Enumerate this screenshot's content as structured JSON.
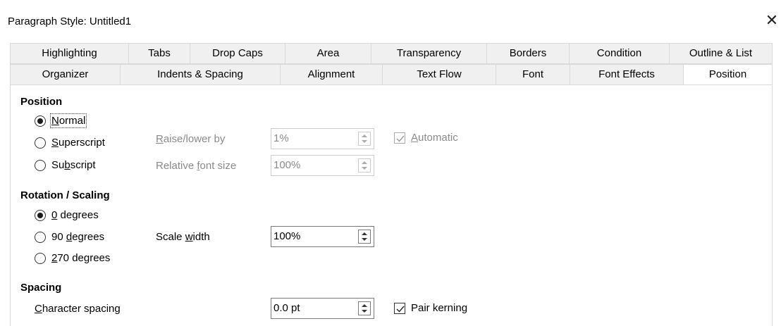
{
  "window": {
    "title": "Paragraph Style: Untitled1",
    "close_glyph": "✕"
  },
  "tabs_row1": [
    {
      "label": "Highlighting"
    },
    {
      "label": "Tabs"
    },
    {
      "label": "Drop Caps"
    },
    {
      "label": "Area"
    },
    {
      "label": "Transparency"
    },
    {
      "label": "Borders"
    },
    {
      "label": "Condition"
    },
    {
      "label": "Outline & List"
    }
  ],
  "tabs_row2": [
    {
      "label": "Organizer"
    },
    {
      "label": "Indents & Spacing"
    },
    {
      "label": "Alignment"
    },
    {
      "label": "Text Flow"
    },
    {
      "label": "Font"
    },
    {
      "label": "Font Effects"
    },
    {
      "label": "Position",
      "active": true
    }
  ],
  "position": {
    "heading": "Position",
    "normal": {
      "pre": "",
      "mn": "N",
      "post": "ormal",
      "checked": true
    },
    "superscript": {
      "pre": "",
      "mn": "S",
      "post": "uperscript",
      "checked": false
    },
    "subscript": {
      "pre": "Su",
      "mn": "b",
      "post": "script",
      "checked": false
    },
    "raise_lower": {
      "pre": "",
      "mn": "R",
      "post": "aise/lower by",
      "value": "1%",
      "disabled": true
    },
    "automatic": {
      "pre": "",
      "mn": "A",
      "post": "utomatic",
      "checked": true,
      "disabled": true
    },
    "relative_font_size": {
      "pre": "Relative ",
      "mn": "f",
      "post": "ont size",
      "value": "100%",
      "disabled": true
    }
  },
  "rotation": {
    "heading": "Rotation / Scaling",
    "deg0": {
      "pre": "",
      "mn": "0",
      "post": " degrees",
      "checked": true
    },
    "deg90": {
      "pre": "90 ",
      "mn": "d",
      "post": "egrees",
      "checked": false
    },
    "deg270": {
      "pre": "",
      "mn": "2",
      "post": "70 degrees",
      "checked": false
    },
    "scale_width": {
      "pre": "Scale ",
      "mn": "w",
      "post": "idth",
      "value": "100%"
    }
  },
  "spacing": {
    "heading": "Spacing",
    "character_spacing": {
      "pre": "",
      "mn": "C",
      "post": "haracter spacing",
      "value": "0.0 pt"
    },
    "pair_kerning": {
      "label": "Pair kerning",
      "checked": true
    }
  }
}
